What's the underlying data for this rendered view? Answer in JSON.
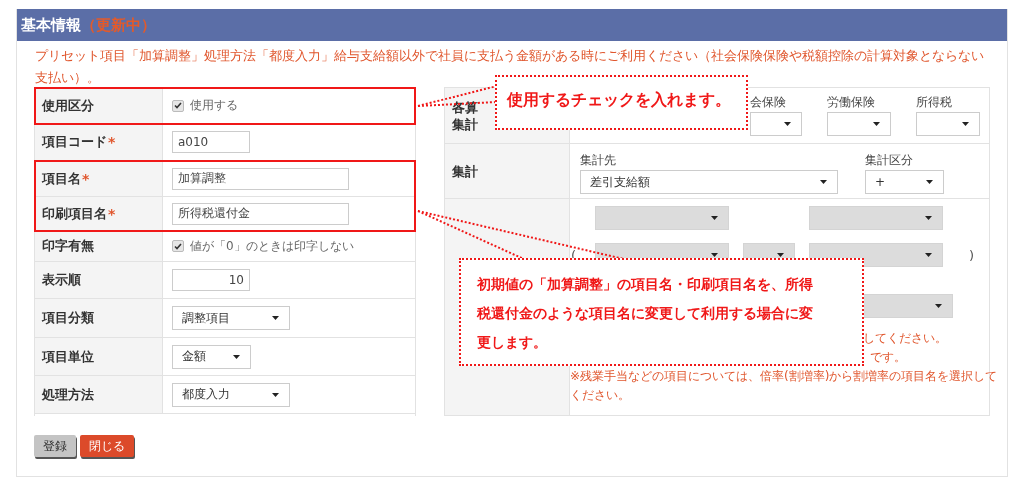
{
  "header": {
    "title": "基本情報",
    "status": "（更新中）"
  },
  "description": "プリセット項目「加算調整」処理方法「都度入力」給与支給額以外で社員に支払う金額がある時にご利用ください（社会保険保険や税額控除の計算対象とならない支払い）。",
  "form_rows": [
    {
      "label": "使用区分",
      "kind": "checkbox",
      "text": "使用する",
      "checked": true,
      "highlighted": true
    },
    {
      "label": "項目コード",
      "required_mark": "*",
      "kind": "text",
      "value": "a010",
      "highlighted": false
    },
    {
      "label": "項目名",
      "required_mark": "*",
      "kind": "wide_text",
      "value": "加算調整",
      "highlighted": true
    },
    {
      "label": "印刷項目名",
      "required_mark": "*",
      "kind": "wide_text",
      "value": "所得税還付金",
      "highlighted": true
    },
    {
      "label": "印字有無",
      "kind": "checkbox",
      "text": "値が「0」のときは印字しない",
      "checked": true,
      "highlighted": false
    },
    {
      "label": "表示順",
      "kind": "number",
      "value": "10",
      "highlighted": false
    },
    {
      "label": "項目分類",
      "kind": "select",
      "value": "調整項目",
      "highlighted": false
    },
    {
      "label": "項目単位",
      "kind": "small_select",
      "value": "金額",
      "highlighted": false
    },
    {
      "label": "処理方法",
      "kind": "select",
      "value": "都度入力",
      "highlighted": false
    }
  ],
  "settings": {
    "attributes": {
      "label_lines": [
        "各算",
        "集計"
      ],
      "columns": [
        {
          "label": "会保険"
        },
        {
          "label": "労働保険"
        },
        {
          "label": "所得税"
        }
      ]
    },
    "totals": {
      "label": "集計",
      "fields": [
        {
          "label": "集計先",
          "value": "差引支給額"
        },
        {
          "label": "集計区分",
          "value": "+"
        }
      ]
    },
    "formula": {
      "open_paren": "(",
      "close_paren": ")",
      "selects": [
        {
          "disabled": true
        },
        {
          "disabled": true
        },
        {
          "disabled": true
        },
        {
          "disabled": true
        },
        {
          "disabled": true
        },
        {
          "disabled": true
        }
      ],
      "notes": [
        {
          "kind": "cut",
          "text": "してください。"
        },
        {
          "kind": "cut",
          "text": "です。"
        },
        {
          "kind": "full",
          "text": "※残業手当などの項目については、倍率(割増率)から割増率の項目名を選択してください。"
        }
      ]
    }
  },
  "buttons": [
    {
      "label": "登録",
      "kind": "secondary"
    },
    {
      "label": "閉じる",
      "kind": "danger"
    }
  ],
  "callouts": [
    {
      "text": "使用するチェックを入れます。"
    },
    {
      "text": "初期値の「加算調整」の項目名・印刷項目名を、所得税還付金のような項目名に変更して利用する場合に変更します。"
    }
  ]
}
